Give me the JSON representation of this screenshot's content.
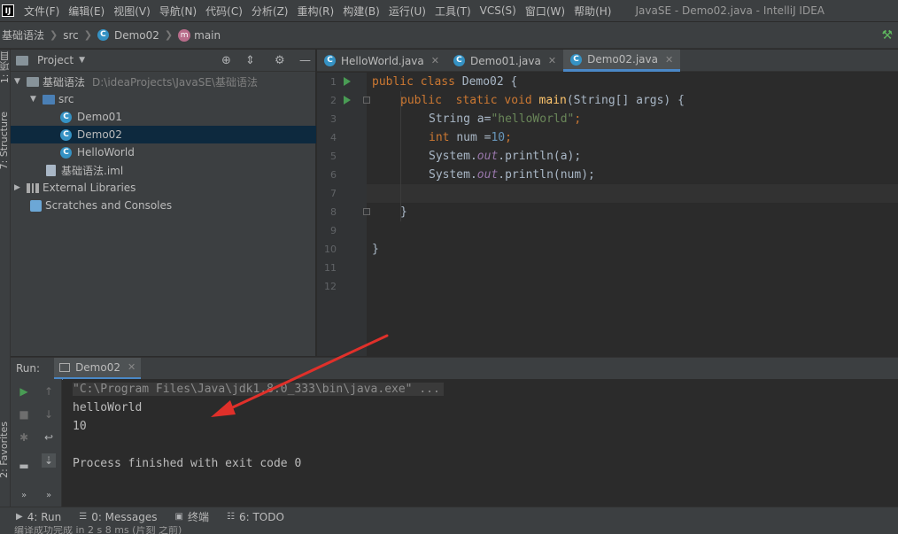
{
  "app": {
    "logo_text": "IJ",
    "title": "JavaSE - Demo02.java - IntelliJ IDEA"
  },
  "menu": [
    "文件(F)",
    "编辑(E)",
    "视图(V)",
    "导航(N)",
    "代码(C)",
    "分析(Z)",
    "重构(R)",
    "构建(B)",
    "运行(U)",
    "工具(T)",
    "VCS(S)",
    "窗口(W)",
    "帮助(H)"
  ],
  "breadcrumb": {
    "project": "基础语法",
    "folder": "src",
    "class": "Demo02",
    "method": "main"
  },
  "left_strip": {
    "project_tab": "1: 项目",
    "structure_tab": "7: Structure",
    "favorites_tab": "2: Favorites"
  },
  "project_panel": {
    "title": "Project",
    "tree": {
      "root": "基础语法",
      "root_path": "D:\\ideaProjects\\JavaSE\\基础语法",
      "src": "src",
      "demo01": "Demo01",
      "demo02": "Demo02",
      "helloworld": "HelloWorld",
      "iml": "基础语法.iml",
      "external_libraries": "External Libraries",
      "scratches": "Scratches and Consoles"
    }
  },
  "editor": {
    "tabs": [
      {
        "label": "HelloWorld.java",
        "active": false
      },
      {
        "label": "Demo01.java",
        "active": false
      },
      {
        "label": "Demo02.java",
        "active": true
      }
    ],
    "line_numbers": [
      "1",
      "2",
      "3",
      "4",
      "5",
      "6",
      "7",
      "8",
      "9",
      "10",
      "11",
      "12"
    ],
    "code": {
      "l1_kw": "public class ",
      "l1_name": "Demo02 {",
      "l2_kw": "public  static void ",
      "l2_fn": "main",
      "l2_rest": "(String[] args) {",
      "l3_a": "String a=",
      "l3_str": "\"helloWorld\"",
      "l3_end": ";",
      "l4_kw": "int ",
      "l4_a": "num =",
      "l4_num": "10",
      "l4_end": ";",
      "l5_a": "System.",
      "l5_fld": "out",
      "l5_b": ".println(a);",
      "l6_a": "System.",
      "l6_fld": "out",
      "l6_b": ".println(num);",
      "l8": "}",
      "l10": "}"
    }
  },
  "run_panel": {
    "label": "Run:",
    "tab": "Demo02",
    "output": {
      "command": "\"C:\\Program Files\\Java\\jdk1.8.0_333\\bin\\java.exe\" ...",
      "line1": "helloWorld",
      "line2": "10",
      "exit": "Process finished with exit code 0"
    }
  },
  "tool_tabs": {
    "run": "4: Run",
    "messages": "0: Messages",
    "terminal": "终端",
    "todo": "6: TODO"
  },
  "status": {
    "text": "编译成功完成 in 2 s 8 ms (片刻 之前)"
  },
  "annotation": {
    "color": "#e0302a"
  }
}
